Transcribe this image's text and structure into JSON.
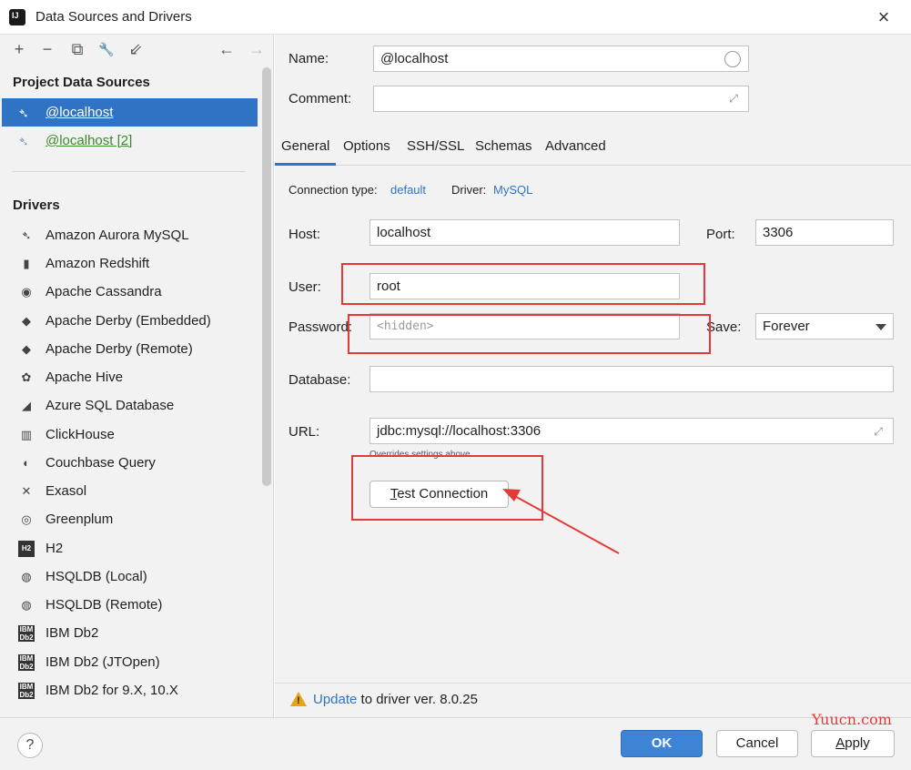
{
  "window": {
    "title": "Data Sources and Drivers",
    "close_icon": "×"
  },
  "toolbar": {
    "add": "+",
    "remove": "−",
    "duplicate": "⧉",
    "settings": "🔧",
    "import": "⇙",
    "back": "←",
    "forward": "→"
  },
  "sidebar": {
    "project_title": "Project Data Sources",
    "data_sources": [
      {
        "label": "@localhost",
        "selected": true
      },
      {
        "label": "@localhost [2]",
        "selected": false
      }
    ],
    "drivers_title": "Drivers",
    "drivers": [
      {
        "label": "Amazon Aurora MySQL",
        "icon": "dolphin-icon"
      },
      {
        "label": "Amazon Redshift",
        "icon": "redshift-icon"
      },
      {
        "label": "Apache Cassandra",
        "icon": "eye-icon"
      },
      {
        "label": "Apache Derby (Embedded)",
        "icon": "hat-icon"
      },
      {
        "label": "Apache Derby (Remote)",
        "icon": "hat-icon"
      },
      {
        "label": "Apache Hive",
        "icon": "bee-icon"
      },
      {
        "label": "Azure SQL Database",
        "icon": "azure-icon"
      },
      {
        "label": "ClickHouse",
        "icon": "bars-icon"
      },
      {
        "label": "Couchbase Query",
        "icon": "couchbase-icon"
      },
      {
        "label": "Exasol",
        "icon": "x-icon"
      },
      {
        "label": "Greenplum",
        "icon": "greenplum-icon"
      },
      {
        "label": "H2",
        "icon": "h2-icon"
      },
      {
        "label": "HSQLDB (Local)",
        "icon": "hsqldb-icon"
      },
      {
        "label": "HSQLDB (Remote)",
        "icon": "hsqldb-icon"
      },
      {
        "label": "IBM Db2",
        "icon": "ibm-icon"
      },
      {
        "label": "IBM Db2 (JTOpen)",
        "icon": "ibm-icon"
      },
      {
        "label": "IBM Db2 for 9.X, 10.X",
        "icon": "ibm-icon"
      }
    ]
  },
  "form": {
    "name_label": "Name:",
    "name_value": "@localhost",
    "comment_label": "Comment:",
    "comment_value": "",
    "tabs": [
      "General",
      "Options",
      "SSH/SSL",
      "Schemas",
      "Advanced"
    ],
    "connection_type_label": "Connection type:",
    "connection_type_value": "default",
    "driver_label": "Driver:",
    "driver_value": "MySQL",
    "host_label": "Host:",
    "host_value": "localhost",
    "port_label": "Port:",
    "port_value": "3306",
    "user_label": "User:",
    "user_value": "root",
    "password_label": "Password:",
    "password_placeholder": "<hidden>",
    "save_label": "Save:",
    "save_value": "Forever",
    "database_label": "Database:",
    "database_value": "",
    "url_label": "URL:",
    "url_value": "jdbc:mysql://localhost:3306",
    "overrides_note": "Overrides settings above",
    "test_connection_first": "T",
    "test_connection_rest": "est Connection"
  },
  "warning": {
    "link": "Update",
    "text": " to driver ver. 8.0.25"
  },
  "footer": {
    "help": "?",
    "ok": "OK",
    "cancel": "Cancel",
    "apply_first": "A",
    "apply_rest": "pply"
  },
  "watermark": "Yuucn.com",
  "colors": {
    "accent": "#2f74c4",
    "highlight_red": "#e53935",
    "selected_bg": "#2f74c4",
    "link_green": "#3a8a2a"
  }
}
